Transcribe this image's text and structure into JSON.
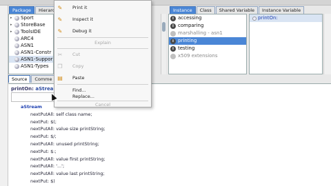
{
  "browser_tabs_left": [
    "Package",
    "Hierarch"
  ],
  "browser_tabs_right": [
    "Instance",
    "Class",
    "Shared Variable",
    "Instance Variable"
  ],
  "packages": [
    {
      "label": "Sport"
    },
    {
      "label": "StoreBase"
    },
    {
      "label": "ToolsIDE"
    },
    {
      "label": "ARC4"
    },
    {
      "label": "ASN1"
    },
    {
      "label": "ASN1-Constr"
    },
    {
      "label": "ASN1-Suppor",
      "selected": true
    },
    {
      "label": "ASN1-Types"
    }
  ],
  "source_tabs": [
    "Source",
    "Comme"
  ],
  "protocols": [
    {
      "label": "accessing",
      "icon": "i"
    },
    {
      "label": "comparing",
      "icon": "i"
    },
    {
      "label": "marshalling - asn1",
      "icon": "",
      "ghost": true,
      "dim": true
    },
    {
      "label": "printing",
      "icon": "i",
      "selected": true
    },
    {
      "label": "testing",
      "icon": "i"
    },
    {
      "label": "x509 extensions",
      "icon": "",
      "ghost": true,
      "dim": true
    }
  ],
  "methods": [
    {
      "label": "printOn:",
      "selected": true
    }
  ],
  "editor": {
    "sig_name": "printOn:",
    "sig_arg": "aStream",
    "receiver": "aStream",
    "lines": [
      "nextPutAll: self class name;",
      "nextPut: $(;",
      "nextPutAll: value size printString;",
      "nextPut: $/;",
      "nextPutAll: unused printString;",
      "nextPut: $:;",
      "nextPutAll: value first printString;",
      "nextPutAll: '...';",
      "nextPutAll: value last printString;",
      "nextPut: $)"
    ]
  },
  "context_menu": {
    "items": [
      {
        "label": "Print it",
        "icon": "print-it-icon",
        "enabled": true
      },
      {
        "label": "Inspect it",
        "icon": "inspect-it-icon",
        "enabled": true
      },
      {
        "label": "Debug it",
        "icon": "debug-it-icon",
        "enabled": true
      },
      {
        "label": "Explain",
        "icon": "",
        "enabled": false,
        "center": true
      },
      {
        "label": "Cut",
        "icon": "scissors-icon",
        "enabled": false
      },
      {
        "label": "Copy",
        "icon": "copy-icon",
        "enabled": false
      },
      {
        "label": "Paste",
        "icon": "paste-icon",
        "enabled": true
      },
      {
        "label": "Find...",
        "icon": "",
        "enabled": true
      },
      {
        "label": "Replace...",
        "icon": "",
        "enabled": true
      },
      {
        "label": "Cancel",
        "icon": "",
        "enabled": false,
        "center": true
      }
    ]
  },
  "colors": {
    "selection": "#4a86d6",
    "icon_accent": "#d18a14"
  }
}
